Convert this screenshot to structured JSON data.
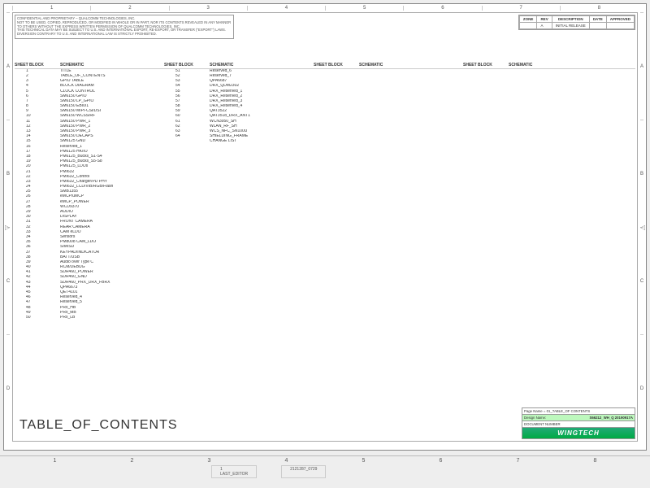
{
  "proprietary": {
    "l1": "CONFIDENTIAL AND PROPRIETARY – QUALCOMM TECHNOLOGIES, INC.",
    "l2": "NOT TO BE USED, COPIED, REPRODUCED, OR MODIFIED IN WHOLE OR IN PART, NOR ITS CONTENTS REVEALED IN ANY MANNER TO OTHERS WITHOUT THE EXPRESS WRITTEN PERMISSION OF QUALCOMM TECHNOLOGIES, INC.",
    "l3": "THIS TECHNICAL DATA MAY BE SUBJECT TO U.S. AND INTERNATIONAL EXPORT, RE-EXPORT, OR TRANSFER (\"EXPORT\") LAWS. DIVERSION CONTRARY TO U.S. AND INTERNATIONAL LAW IS STRICTLY PROHIBITED."
  },
  "rev_header": {
    "zone": "ZONE",
    "rev": "REV",
    "desc": "DESCRIPTION",
    "date": "DATE",
    "approved": "APPROVED"
  },
  "rev_row": {
    "zone": "",
    "rev": "A",
    "desc": "INITIAL RELEASE",
    "date": "",
    "approved": ""
  },
  "col_header": {
    "sheet": "SHEET BLOCK",
    "schem": "SCHEMATIC"
  },
  "ruler": {
    "nums": [
      "8",
      "7",
      "6",
      "5",
      "4",
      "3",
      "2",
      "1"
    ],
    "lets": [
      "D",
      "C",
      "B",
      "A"
    ]
  },
  "entries_col1": [
    {
      "n": "1",
      "s": "TITLE"
    },
    {
      "n": "2",
      "s": "TABLE_OF_CONTENTS"
    },
    {
      "n": "3",
      "s": "GPIO TABLE"
    },
    {
      "n": "4",
      "s": "BLOCK DIAGRAM"
    },
    {
      "n": "5",
      "s": "CLOCK CONTROL"
    },
    {
      "n": "6",
      "s": "SM6150 GPIO"
    },
    {
      "n": "7",
      "s": "SM6150 LP_GPIO"
    },
    {
      "n": "8",
      "s": "SM6150 EBI0/1"
    },
    {
      "n": "9",
      "s": "SM6150 MIPI-CSI/DSI"
    },
    {
      "n": "10",
      "s": "SM6150 WCSS/RF"
    },
    {
      "n": "11",
      "s": "SM6150 PWR_1"
    },
    {
      "n": "12",
      "s": "SM6150 PWR_2"
    },
    {
      "n": "13",
      "s": "SM6150 PWR_3"
    },
    {
      "n": "14",
      "s": "SM6150 DECAPS"
    },
    {
      "n": "15",
      "s": "SM6125 GND"
    },
    {
      "n": "16",
      "s": "Reserved_1"
    },
    {
      "n": "17",
      "s": "PM6125 HK/IO"
    },
    {
      "n": "18",
      "s": "PM6125_Bucks_S1-S4"
    },
    {
      "n": "19",
      "s": "PM6125_Bucks_S5-S8"
    },
    {
      "n": "20",
      "s": "PM6125_LDOs"
    },
    {
      "n": "21",
      "s": "PMI632"
    },
    {
      "n": "22",
      "s": "PMI632_Control"
    },
    {
      "n": "23",
      "s": "PMI632_Charger/PD PHY"
    },
    {
      "n": "24",
      "s": "PMI632_LCD/VIB/RGB/Flash"
    },
    {
      "n": "25",
      "s": "SMB1355"
    },
    {
      "n": "26",
      "s": "eMCP/uMCP"
    },
    {
      "n": "27",
      "s": "eMCP_POWER"
    },
    {
      "n": "28",
      "s": "WCD9370"
    },
    {
      "n": "29",
      "s": "AUDIO"
    },
    {
      "n": "30",
      "s": "DISPLAY"
    },
    {
      "n": "31",
      "s": "FRONT CAMERA"
    },
    {
      "n": "32",
      "s": "REAR CAMERA"
    },
    {
      "n": "33",
      "s": "CAM eLDO"
    },
    {
      "n": "34",
      "s": "Sensors"
    },
    {
      "n": "35",
      "s": "PM8008 CAM_LDO"
    },
    {
      "n": "36",
      "s": "SIM/SD"
    },
    {
      "n": "37",
      "s": "KEYPAD/INDICATOR"
    },
    {
      "n": "38",
      "s": "BATT/USB"
    },
    {
      "n": "39",
      "s": "Audio over Type C"
    },
    {
      "n": "40",
      "s": "RCM/DEBUG"
    },
    {
      "n": "41",
      "s": "SDR460_POWER"
    },
    {
      "n": "42",
      "s": "SDR460_GND"
    },
    {
      "n": "43",
      "s": "SDR460_PRX_DRX_FBRX"
    },
    {
      "n": "44",
      "s": "QPA6673"
    },
    {
      "n": "45",
      "s": "QET4101"
    },
    {
      "n": "46",
      "s": "Reserved_4"
    },
    {
      "n": "47",
      "s": "Reserved_5"
    },
    {
      "n": "48",
      "s": "PRx_HB"
    },
    {
      "n": "49",
      "s": "PRx_MB"
    },
    {
      "n": "50",
      "s": "PRx_LB"
    }
  ],
  "entries_col2": [
    {
      "n": "51",
      "s": "Reserved_6"
    },
    {
      "n": "52",
      "s": "Reserved_7"
    },
    {
      "n": "53",
      "s": "QPA6687"
    },
    {
      "n": "54",
      "s": "DRX_QDM2302"
    },
    {
      "n": "55",
      "s": "DRX_Reserved_1"
    },
    {
      "n": "56",
      "s": "DRX_Reserved_2"
    },
    {
      "n": "57",
      "s": "DRX_Reserved_3"
    },
    {
      "n": "58",
      "s": "DRX_Reserved_4"
    },
    {
      "n": "59",
      "s": "QAT3522"
    },
    {
      "n": "60",
      "s": "QAT3518_DRX_ANT1"
    },
    {
      "n": "61",
      "s": "WCN3950_SH"
    },
    {
      "n": "62",
      "s": "WLAN_RF_SH"
    },
    {
      "n": "63",
      "s": "WCS_NFC_SN100U"
    },
    {
      "n": "64",
      "s": "SHIELDING_FRAME"
    },
    {
      "n": "",
      "s": "CHANGE LIST"
    }
  ],
  "big_title": "TABLE_OF_CONTENTS",
  "titleblock": {
    "pagename_label": "Page Name = 01_TABLE_OF CONTENTS",
    "design_label": "Design Name: ",
    "design_value": "S66212_WH_Q 20190917A",
    "docnum": "DOCUMENT NUMBER",
    "logo": "WINGTECH"
  },
  "footer": {
    "nums": [
      "8",
      "7",
      "6",
      "5",
      "4",
      "3",
      "2",
      "1"
    ],
    "last_label": "LAST_EDITOR",
    "last_val": "1",
    "date_label": "",
    "date_val": "2121287_0729"
  }
}
